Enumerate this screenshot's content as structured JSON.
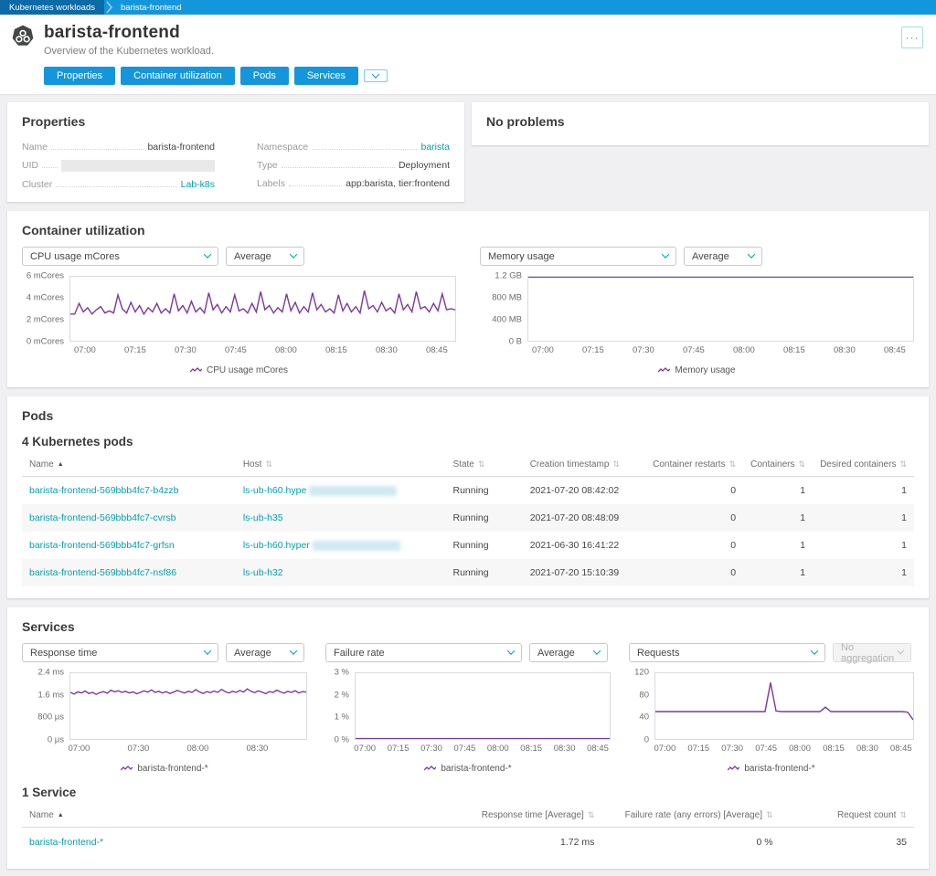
{
  "colors": {
    "accent_blue": "#1496dc",
    "breadcrumb_dark": "#0c6ba6",
    "link_teal": "#00a1b2",
    "chart_line_purple": "#7c38a2"
  },
  "breadcrumb": {
    "items": [
      "Kubernetes workloads",
      "barista-frontend"
    ]
  },
  "header": {
    "title": "barista-frontend",
    "subtitle": "Overview of the Kubernetes workload.",
    "nav": [
      "Properties",
      "Container utilization",
      "Pods",
      "Services"
    ],
    "more": "···"
  },
  "properties": {
    "title": "Properties",
    "left": [
      {
        "label": "Name",
        "value": "barista-frontend"
      },
      {
        "label": "UID",
        "value": ""
      },
      {
        "label": "Cluster",
        "value": "Lab-k8s"
      }
    ],
    "right": [
      {
        "label": "Namespace",
        "value": "barista"
      },
      {
        "label": "Type",
        "value": "Deployment"
      },
      {
        "label": "Labels",
        "value": "app:barista, tier:frontend"
      }
    ]
  },
  "problems": {
    "title": "No problems"
  },
  "container_utilization": {
    "title": "Container utilization",
    "panels": [
      {
        "metric": "CPU usage mCores",
        "aggregation": "Average",
        "legend": "CPU usage mCores"
      },
      {
        "metric": "Memory usage",
        "aggregation": "Average",
        "legend": "Memory usage"
      }
    ]
  },
  "pods": {
    "title": "Pods",
    "subtitle": "4 Kubernetes pods",
    "columns": [
      "Name",
      "Host",
      "State",
      "Creation timestamp",
      "Container restarts",
      "Containers",
      "Desired containers"
    ],
    "rows": [
      {
        "name": "barista-frontend-569bbb4fc7-b4zzb",
        "host": "ls-ub-h60.hype",
        "state": "Running",
        "created": "2021-07-20 08:42:02",
        "restarts": "0",
        "containers": "1",
        "desired": "1"
      },
      {
        "name": "barista-frontend-569bbb4fc7-cvrsb",
        "host": "ls-ub-h35",
        "state": "Running",
        "created": "2021-07-20 08:48:09",
        "restarts": "0",
        "containers": "1",
        "desired": "1"
      },
      {
        "name": "barista-frontend-569bbb4fc7-grfsn",
        "host": "ls-ub-h60.hyper",
        "state": "Running",
        "created": "2021-06-30 16:41:22",
        "restarts": "0",
        "containers": "1",
        "desired": "1"
      },
      {
        "name": "barista-frontend-569bbb4fc7-nsf86",
        "host": "ls-ub-h32",
        "state": "Running",
        "created": "2021-07-20 15:10:39",
        "restarts": "0",
        "containers": "1",
        "desired": "1"
      }
    ]
  },
  "services": {
    "title": "Services",
    "subtitle": "1 Service",
    "panels": [
      {
        "metric": "Response time",
        "aggregation": "Average",
        "legend": "barista-frontend-*"
      },
      {
        "metric": "Failure rate",
        "aggregation": "Average",
        "legend": "barista-frontend-*"
      },
      {
        "metric": "Requests",
        "aggregation": "No aggregation",
        "legend": "barista-frontend-*"
      }
    ],
    "columns": [
      "Name",
      "Response time [Average]",
      "Failure rate (any errors) [Average]",
      "Request count"
    ],
    "rows": [
      {
        "name": "barista-frontend-*",
        "response_time": "1.72 ms",
        "failure_rate": "0 %",
        "request_count": "35"
      }
    ]
  },
  "chart_data": [
    {
      "type": "line",
      "title": "CPU usage mCores",
      "ylabel": "mCores",
      "color": "#7c38a2",
      "ymax": 6,
      "ylim": [
        0,
        6
      ],
      "y_ticks": [
        "6 mCores",
        "4 mCores",
        "2 mCores",
        "0 mCores"
      ],
      "x_ticks": [
        "07:00",
        "07:15",
        "07:30",
        "07:45",
        "08:00",
        "08:15",
        "08:30",
        "08:45"
      ],
      "values": [
        2.5,
        2.5,
        3.5,
        2.7,
        3.1,
        2.5,
        2.9,
        3.2,
        2.6,
        2.8,
        2.6,
        4.3,
        3.0,
        2.6,
        3.6,
        2.7,
        3.3,
        2.5,
        3.1,
        2.7,
        3.5,
        2.6,
        3.0,
        2.6,
        4.4,
        2.8,
        3.3,
        2.6,
        3.7,
        2.7,
        3.1,
        2.6,
        4.5,
        2.9,
        3.4,
        2.6,
        3.2,
        2.7,
        4.3,
        2.8,
        3.0,
        2.6,
        3.5,
        2.7,
        4.6,
        2.9,
        3.3,
        2.6,
        3.1,
        2.7,
        4.4,
        2.8,
        3.6,
        2.6,
        3.2,
        2.7,
        4.5,
        2.9,
        3.4,
        2.7,
        3.0,
        2.6,
        4.3,
        2.8,
        3.5,
        2.7,
        3.2,
        2.6,
        4.7,
        3.0,
        3.3,
        2.7,
        3.6,
        2.8,
        3.1,
        2.6,
        4.4,
        2.9,
        3.4,
        2.7,
        4.6,
        3.0,
        3.2,
        2.7,
        3.5,
        2.8,
        4.4,
        2.9,
        3.0,
        2.9
      ]
    },
    {
      "type": "line",
      "title": "Memory usage",
      "ylabel": "memory",
      "color": "#7c38a2",
      "ymax": 1.2,
      "ylim": [
        0,
        1.2
      ],
      "y_ticks": [
        "1.2 GB",
        "800 MB",
        "400 MB",
        "0 B"
      ],
      "x_ticks": [
        "07:00",
        "07:15",
        "07:30",
        "07:45",
        "08:00",
        "08:15",
        "08:30",
        "08:45"
      ],
      "values": [
        1.195,
        1.195
      ]
    },
    {
      "type": "line",
      "title": "Response time",
      "ylabel": "ms",
      "color": "#7c38a2",
      "ymax": 2.4,
      "ylim": [
        0,
        2.4
      ],
      "y_ticks": [
        "2.4 ms",
        "1.6 ms",
        "800 µs",
        "0 µs"
      ],
      "x_ticks": [
        "07:00",
        "07:30",
        "08:00",
        "08:30"
      ],
      "values": [
        1.7,
        1.64,
        1.72,
        1.68,
        1.75,
        1.66,
        1.7,
        1.63,
        1.69,
        1.73,
        1.67,
        1.78,
        1.72,
        1.76,
        1.7,
        1.74,
        1.68,
        1.72,
        1.65,
        1.7,
        1.76,
        1.71,
        1.79,
        1.7,
        1.74,
        1.68,
        1.73,
        1.66,
        1.71,
        1.77,
        1.72,
        1.68,
        1.74,
        1.7,
        1.8,
        1.72,
        1.66,
        1.73,
        1.69,
        1.75,
        1.7,
        1.81,
        1.73,
        1.68,
        1.74,
        1.7,
        1.77,
        1.71,
        1.83,
        1.74,
        1.69,
        1.76,
        1.71,
        1.65,
        1.73,
        1.7,
        1.78,
        1.72,
        1.67,
        1.74,
        1.7,
        1.76,
        1.68,
        1.73,
        1.71
      ]
    },
    {
      "type": "line",
      "title": "Failure rate",
      "ylabel": "%",
      "color": "#7c38a2",
      "ymax": 3,
      "ylim": [
        0,
        3
      ],
      "y_ticks": [
        "3 %",
        "2 %",
        "1 %",
        "0 %"
      ],
      "x_ticks": [
        "07:00",
        "07:15",
        "07:30",
        "07:45",
        "08:00",
        "08:15",
        "08:30",
        "08:45"
      ],
      "values": [
        0.02,
        0.02
      ]
    },
    {
      "type": "line",
      "title": "Requests",
      "ylabel": "count",
      "color": "#7c38a2",
      "ymax": 120,
      "ylim": [
        0,
        120
      ],
      "y_ticks": [
        "120",
        "80",
        "40",
        "0"
      ],
      "x_ticks": [
        "07:00",
        "07:15",
        "07:30",
        "07:45",
        "08:00",
        "08:15",
        "08:30",
        "08:45"
      ],
      "values": [
        50,
        50,
        50,
        50,
        50,
        50,
        50,
        50,
        50,
        50,
        50,
        50,
        50,
        50,
        50,
        50,
        50,
        50,
        50,
        50,
        50,
        103,
        51,
        50,
        50,
        50,
        50,
        50,
        50,
        50,
        50,
        58,
        50,
        50,
        50,
        50,
        50,
        50,
        50,
        50,
        50,
        50,
        50,
        50,
        50,
        50,
        49,
        35
      ]
    }
  ]
}
